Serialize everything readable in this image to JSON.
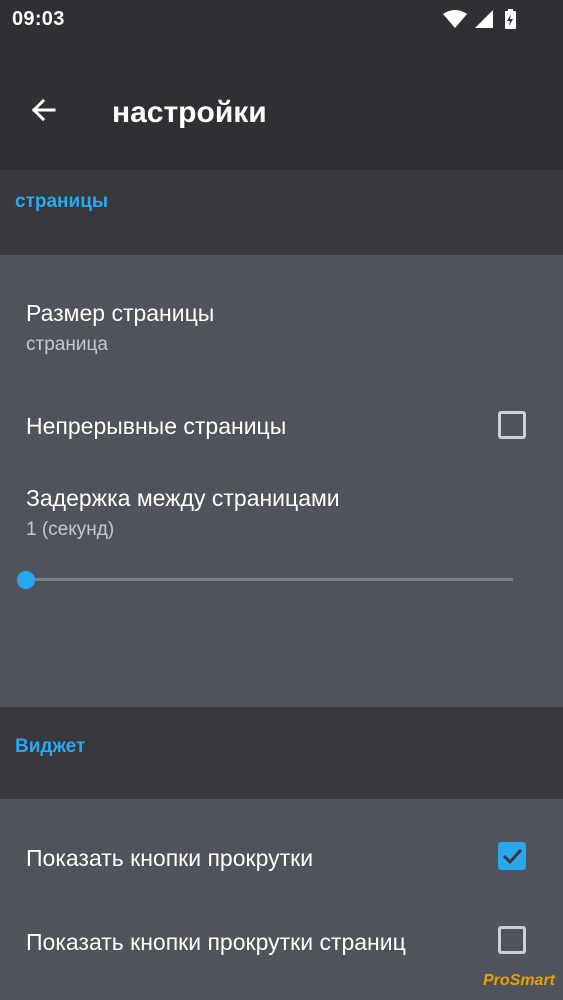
{
  "status_bar": {
    "time": "09:03"
  },
  "app_bar": {
    "title": "настройки"
  },
  "sections": {
    "pages": {
      "label": "страницы",
      "page_size": {
        "title": "Размер страницы",
        "summary": "страница"
      },
      "continuous_pages": {
        "title": "Непрерывные страницы",
        "checked": false
      },
      "page_delay": {
        "title": "Задержка между страницами",
        "summary": "1 (секунд)",
        "slider_value": 1
      }
    },
    "widget": {
      "label": "Виджет",
      "show_scroll_buttons": {
        "title": "Показать кнопки прокрутки",
        "checked": true
      },
      "show_page_scroll_buttons": {
        "title": "Показать кнопки прокрутки страниц",
        "checked": false
      }
    }
  },
  "watermark": "ProSmart",
  "colors": {
    "accent": "#29a8f0",
    "background": "#50525c",
    "header": "#303034",
    "category": "#38383d"
  }
}
